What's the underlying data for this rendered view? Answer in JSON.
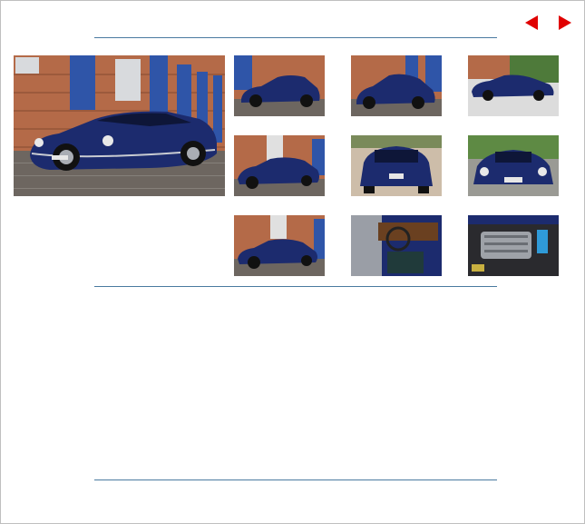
{
  "navigation": {
    "previous_icon": "triangle-left-icon",
    "next_icon": "triangle-right-icon",
    "arrow_color": "#e00000"
  },
  "gallery": {
    "accent_line_color": "#4a7aa0",
    "car_color": "#1c2b6e",
    "main_photo": "car-front-three-quarter-photo",
    "thumbnails": [
      "car-side-brick-wall-photo",
      "car-rear-three-quarter-brick-wall-photo",
      "car-side-garden-photo",
      "car-front-three-quarter-brick-wall-photo",
      "car-rear-view-photo",
      "car-front-view-photo",
      "car-three-quarter-blue-door-photo",
      "car-interior-dashboard-photo",
      "car-engine-bay-photo"
    ]
  }
}
